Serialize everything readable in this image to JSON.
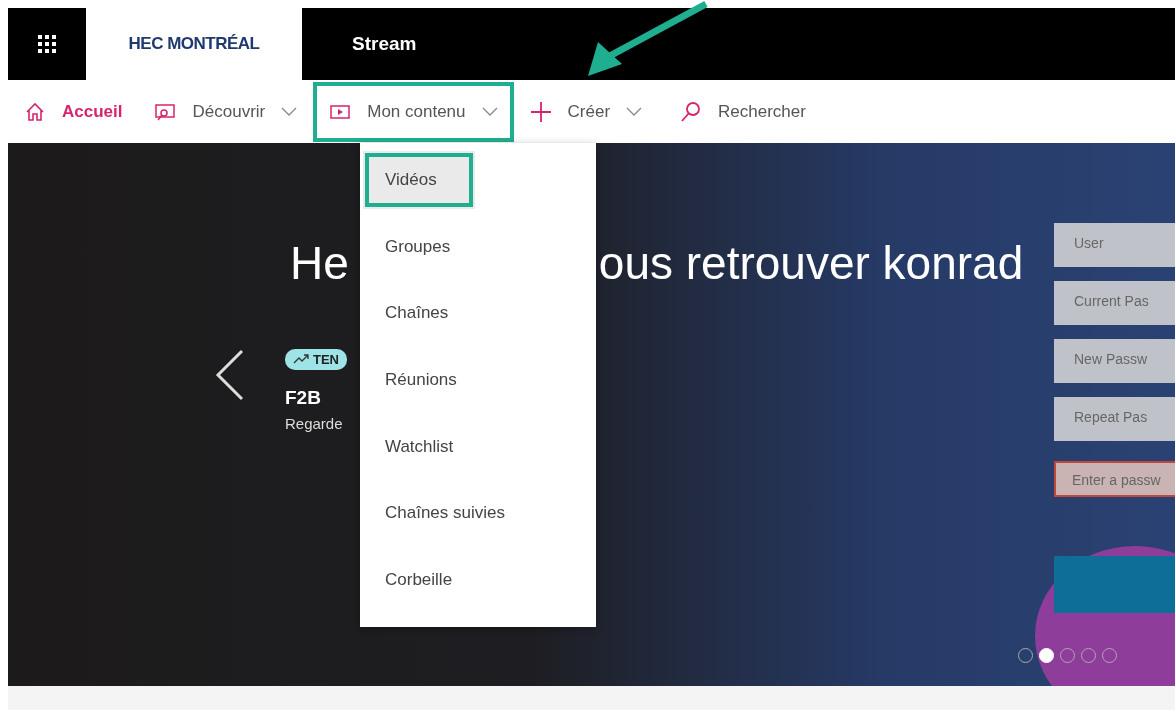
{
  "top_bar": {
    "logo": "HEC MONTRÉAL",
    "app_name": "Stream"
  },
  "nav": [
    {
      "label": "Accueil",
      "kind": "home",
      "selected": true,
      "dropdown": false,
      "highlighted": false
    },
    {
      "label": "Découvrir",
      "kind": "discover",
      "selected": false,
      "dropdown": true,
      "highlighted": false
    },
    {
      "label": "Mon contenu",
      "kind": "video",
      "selected": false,
      "dropdown": true,
      "highlighted": true
    },
    {
      "label": "Créer",
      "kind": "plus",
      "selected": false,
      "dropdown": true,
      "highlighted": false
    },
    {
      "label": "Rechercher",
      "kind": "search",
      "selected": false,
      "dropdown": false,
      "highlighted": false
    }
  ],
  "menu": [
    {
      "label": "Vidéos",
      "selected": true,
      "highlighted": true
    },
    {
      "label": "Groupes",
      "selected": false,
      "highlighted": false
    },
    {
      "label": "Chaînes",
      "selected": false,
      "highlighted": false
    },
    {
      "label": "Réunions",
      "selected": false,
      "highlighted": false
    },
    {
      "label": "Watchlist",
      "selected": false,
      "highlighted": false
    },
    {
      "label": "Chaînes suivies",
      "selected": false,
      "highlighted": false
    },
    {
      "label": "Corbeille",
      "selected": false,
      "highlighted": false
    }
  ],
  "hero": {
    "title_left": "He",
    "title_right": "ous retrouver konrad",
    "badge": "TEN",
    "video_title": "F2B",
    "subtitle": "Regarde",
    "form_fields": [
      {
        "label": "User",
        "kind": "field"
      },
      {
        "label": "Current Pas",
        "kind": "field"
      },
      {
        "label": "New Passw",
        "kind": "field"
      },
      {
        "label": "Repeat Pas",
        "kind": "field"
      },
      {
        "label": "Enter a passw",
        "kind": "error"
      },
      {
        "kind": "button"
      }
    ],
    "dots": [
      {
        "selected": false
      },
      {
        "selected": true
      },
      {
        "selected": false
      },
      {
        "selected": false
      },
      {
        "selected": false
      }
    ]
  }
}
